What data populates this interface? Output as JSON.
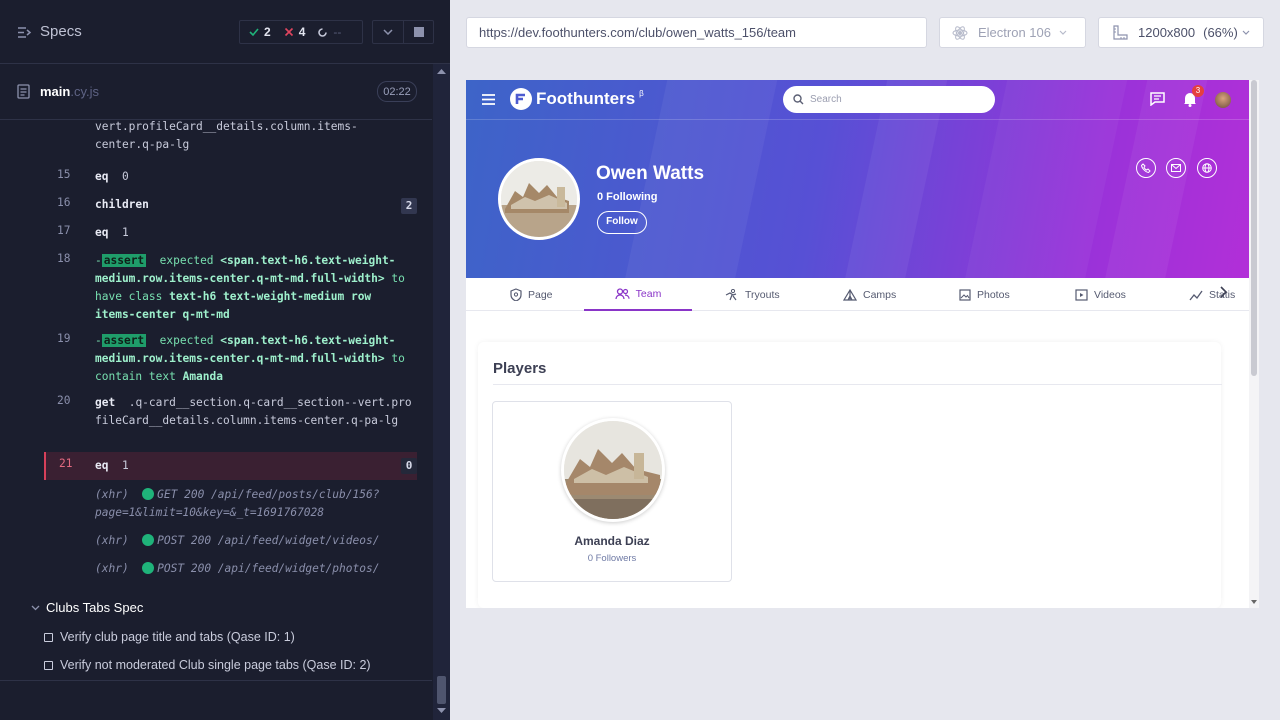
{
  "reporter": {
    "specs_label": "Specs",
    "stats": {
      "passed": "2",
      "failed": "4",
      "pending": "--"
    },
    "file": {
      "name": "main",
      "ext": ".cy.js",
      "duration": "02:22"
    },
    "commands": [
      {
        "num": "",
        "lines": [
          "vert.profileCard__details.column.items-",
          "center.q-pa-lg"
        ],
        "first": ""
      },
      {
        "num": "15",
        "name": "eq",
        "args": "0"
      },
      {
        "num": "16",
        "name": "children",
        "args": "",
        "badge": "2"
      },
      {
        "num": "17",
        "name": "eq",
        "args": "1"
      },
      {
        "num": "18",
        "assert": "assert",
        "parts": [
          "expected",
          "<span.text-h6.text-weight-medium.row.items-center.q-mt-md.full-width>",
          "to have class",
          "text-h6 text-weight-medium row items-center q-mt-md"
        ]
      },
      {
        "num": "19",
        "assert": "assert",
        "parts": [
          "expected",
          "<span.text-h6.text-weight-medium.row.items-center.q-mt-md.full-width>",
          "to contain text",
          "Amanda"
        ]
      },
      {
        "num": "20",
        "name": "get",
        "args": ".q-card__section.q-card__section--vert.profileCard__details.column.items-center.q-pa-lg"
      },
      {
        "num": "21",
        "name": "eq",
        "args": "1",
        "badge": "0"
      }
    ],
    "xhr": [
      {
        "tag": "(xhr)",
        "line1": "GET 200 /api/feed/posts/club/156?",
        "line2": "page=1&limit=10&key=&_t=1691767028"
      },
      {
        "tag": "(xhr)",
        "line1": "POST 200 /api/feed/widget/videos/"
      },
      {
        "tag": "(xhr)",
        "line1": "POST 200 /api/feed/widget/photos/"
      }
    ],
    "suite": "Clubs Tabs Spec",
    "tests": [
      "Verify club page title and tabs (Qase ID: 1)",
      "Verify not moderated Club single page tabs (Qase ID: 2)"
    ]
  },
  "aut_bar": {
    "url": "https://dev.foothunters.com/club/owen_watts_156/team",
    "browser": "Electron 106",
    "viewport": "1200x800",
    "scale": "(66%)"
  },
  "site": {
    "logo": "Foothunters",
    "logo_beta": "β",
    "search_placeholder": "Search",
    "notif_count": "3",
    "club_name": "Owen Watts",
    "following": "0 Following",
    "follow_label": "Follow",
    "tabs": [
      "Page",
      "Team",
      "Tryouts",
      "Camps",
      "Photos",
      "Videos",
      "Statis"
    ],
    "active_tab": "Team",
    "players_title": "Players",
    "player": {
      "name": "Amanda Diaz",
      "followers": "0 Followers"
    }
  },
  "colors": {
    "accent": "#8a35c8",
    "pass": "#1fb37a",
    "fail": "#d7405a"
  }
}
